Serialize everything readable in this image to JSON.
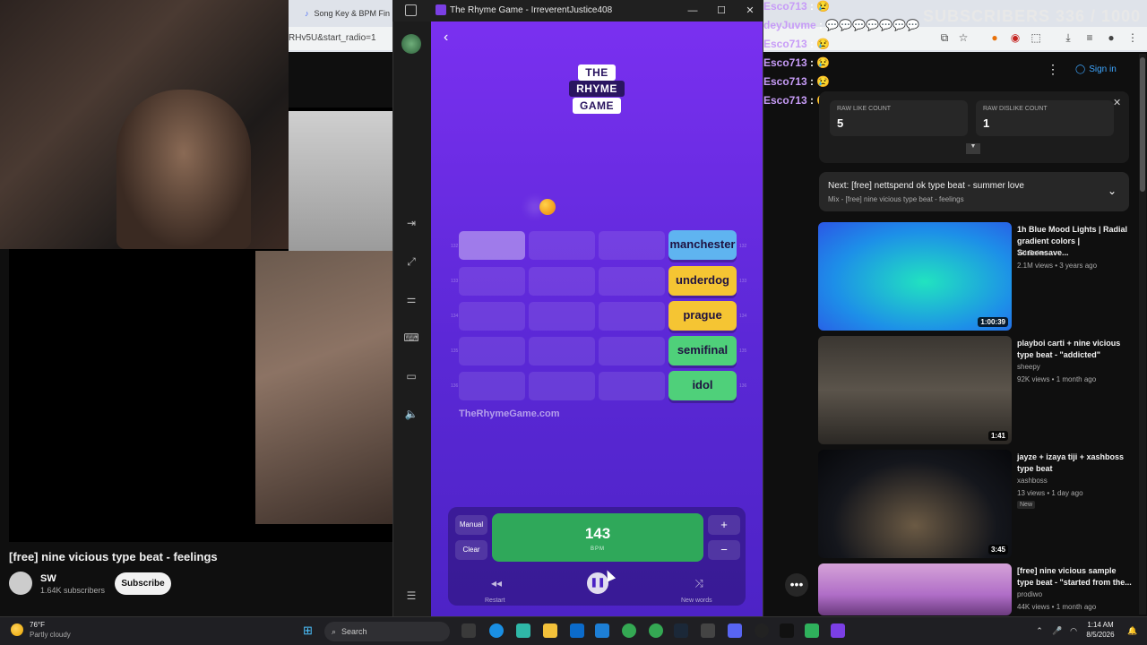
{
  "browser": {
    "tab_title": "Song Key & BPM Fin",
    "url_fragment": "RHv5U&start_radio=1"
  },
  "stream_overlay": {
    "subscriber_counter": "SUBSCRIBERS 336 / 1000",
    "chat": [
      {
        "user": "Esco713",
        "msg": "😢"
      },
      {
        "user": "deyJuvme",
        "msg": "💬💬💬💬💬💬💬"
      },
      {
        "user": "Esco713",
        "msg": "😢"
      },
      {
        "user": "Esco713",
        "msg": "😢"
      },
      {
        "user": "Esco713",
        "msg": "😢"
      },
      {
        "user": "Esco713",
        "msg": "😢"
      }
    ]
  },
  "youtube": {
    "video_title": "[free] nine vicious type beat - feelings",
    "channel_name": "SW",
    "channel_subs": "1.64K subscribers",
    "subscribe_label": "Subscribe",
    "sign_in_label": "Sign in",
    "more_label": "•••",
    "raw_like_label": "RAW LIKE COUNT",
    "raw_like_value": "5",
    "raw_dislike_label": "RAW DISLIKE COUNT",
    "raw_dislike_value": "1",
    "next_label": "Next: [free] nettspend ok type beat - summer love",
    "next_sub": "Mix - [free] nine vicious type beat - feelings",
    "recommendations": [
      {
        "title": "1h Blue Mood Lights | Radial gradient colors | Screensave...",
        "channel": "Yiil Bake",
        "meta": "2.1M views • 3 years ago",
        "duration": "1:00:39",
        "badge": ""
      },
      {
        "title": "playboi carti + nine vicious type beat - \"addicted\"",
        "channel": "sheepy",
        "meta": "92K views • 1 month ago",
        "duration": "1:41",
        "badge": ""
      },
      {
        "title": "jayze + izaya tiji + xashboss type beat",
        "channel": "xashboss",
        "meta": "13 views • 1 day ago",
        "duration": "3:45",
        "badge": "New"
      },
      {
        "title": "[free] nine vicious sample type beat - \"started from the...",
        "channel": "prodiwo",
        "meta": "44K views • 1 month ago",
        "duration": "",
        "badge": ""
      }
    ]
  },
  "game_window": {
    "title": "The Rhyme Game - IrreverentJustice408",
    "logo_top": "THE",
    "logo_mid": "RHYME",
    "logo_bot": "GAME",
    "words": [
      {
        "text": "manchester",
        "color": "#5fb4f0"
      },
      {
        "text": "underdog",
        "color": "#f5c533"
      },
      {
        "text": "prague",
        "color": "#f5c533"
      },
      {
        "text": "semifinal",
        "color": "#4fd07a"
      },
      {
        "text": "idol",
        "color": "#4fd07a"
      }
    ],
    "row_numbers": [
      "132",
      "133",
      "134",
      "135",
      "136"
    ],
    "site": "TheRhymeGame.com",
    "manual_label": "Manual",
    "clear_label": "Clear",
    "bpm_value": "143",
    "bpm_label": "BPM",
    "plus_label": "+",
    "minus_label": "−",
    "restart_label": "Restart",
    "new_words_label": "New words"
  },
  "taskbar": {
    "temp": "76°F",
    "weather": "Partly cloudy",
    "search_label": "Search",
    "time": "1:14 AM",
    "date": "8/5/2026"
  }
}
